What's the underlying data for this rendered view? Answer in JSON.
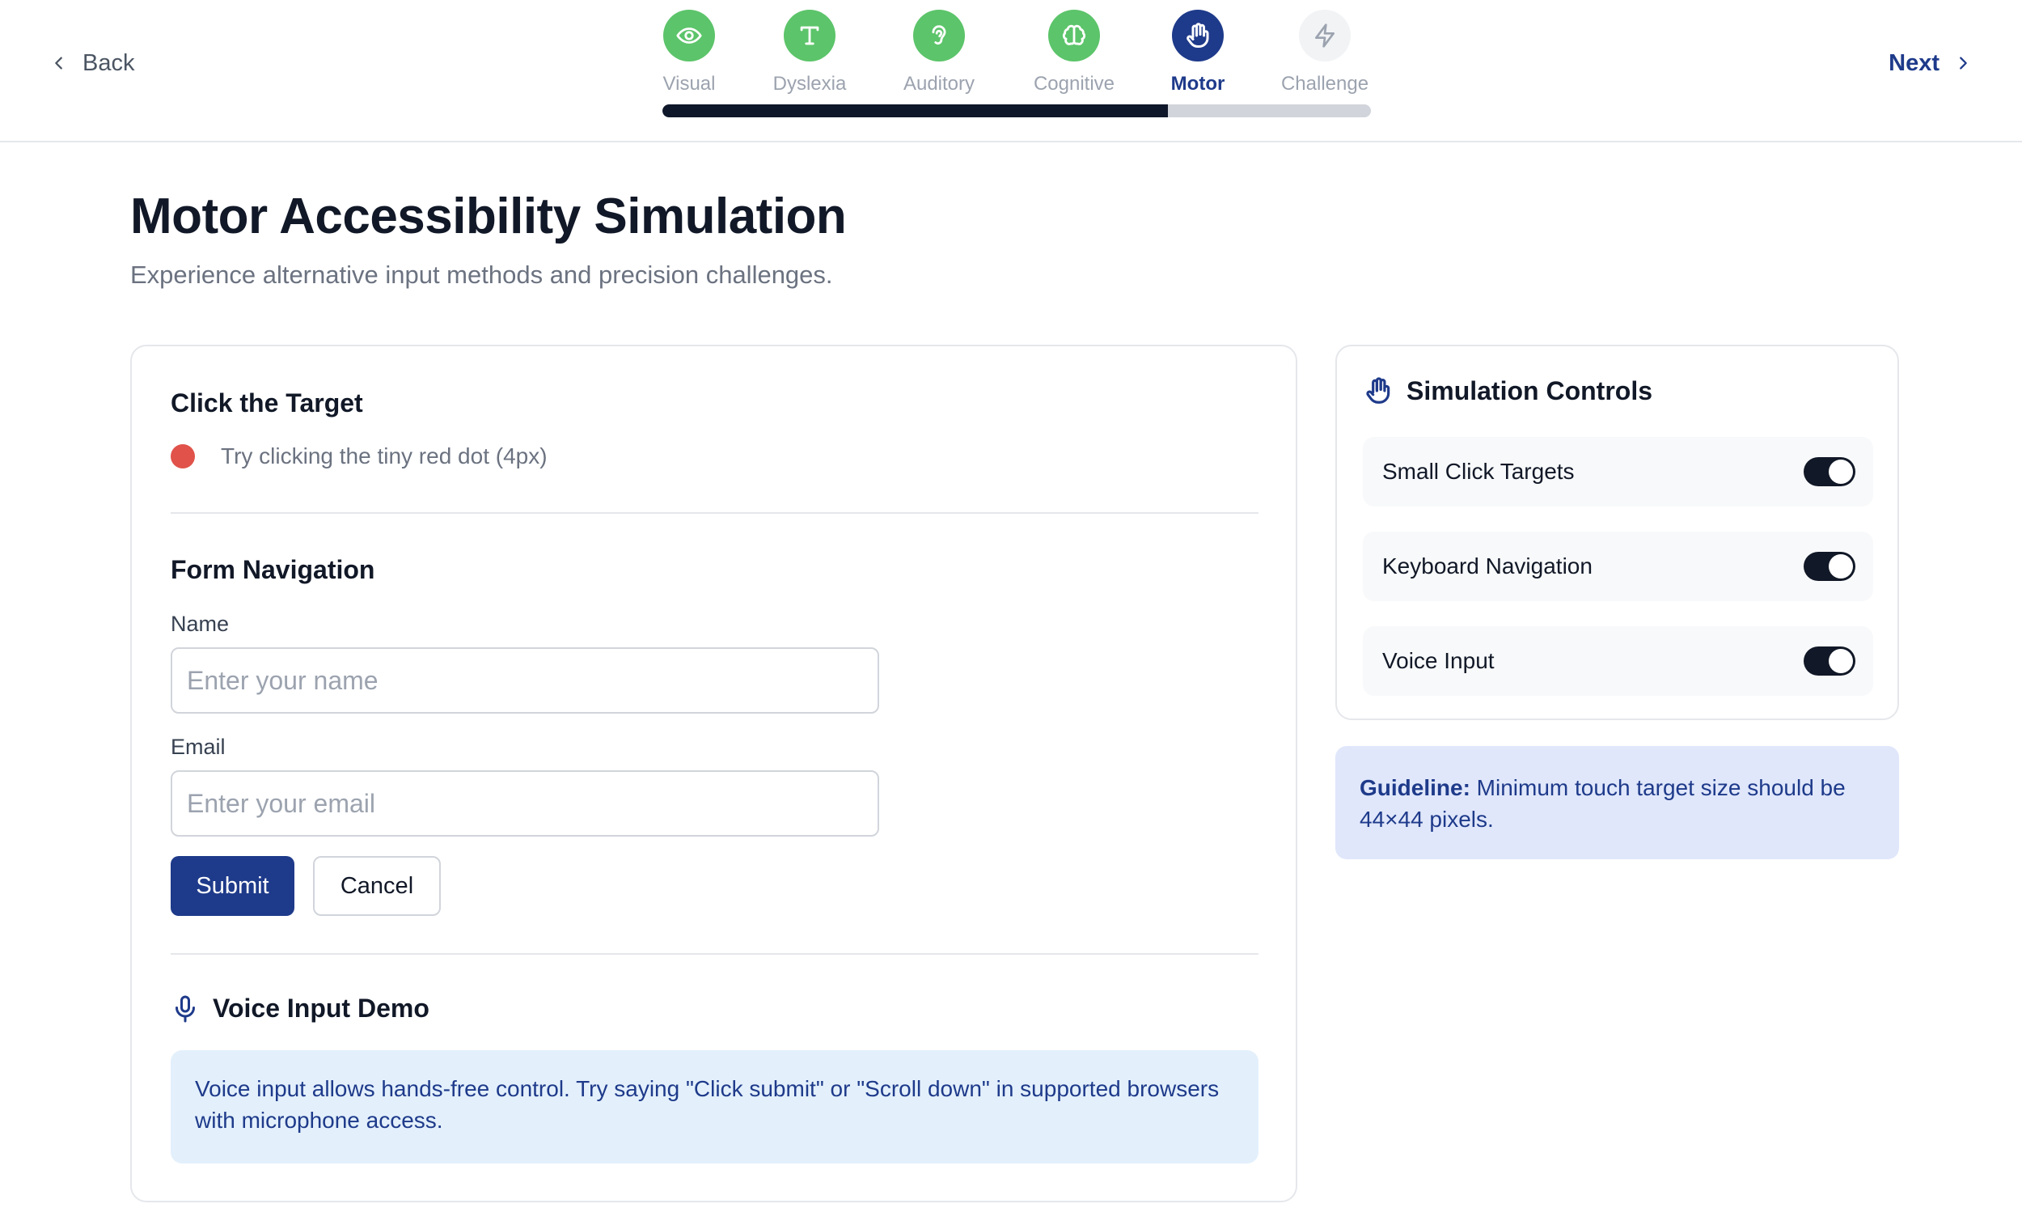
{
  "nav": {
    "back_label": "Back",
    "next_label": "Next",
    "progress_fraction": 0.714,
    "steps": [
      {
        "label": "Visual",
        "status": "done",
        "icon": "eye-icon"
      },
      {
        "label": "Dyslexia",
        "status": "done",
        "icon": "letter-t-icon"
      },
      {
        "label": "Auditory",
        "status": "done",
        "icon": "ear-icon"
      },
      {
        "label": "Cognitive",
        "status": "done",
        "icon": "brain-icon"
      },
      {
        "label": "Motor",
        "status": "active",
        "icon": "hand-icon"
      },
      {
        "label": "Challenge",
        "status": "todo",
        "icon": "lightning-icon"
      }
    ]
  },
  "header": {
    "title": "Motor Accessibility Simulation",
    "subtitle": "Experience alternative input methods and precision challenges."
  },
  "target": {
    "title": "Click the Target",
    "hint": "Try clicking the tiny red dot (4px)"
  },
  "form": {
    "title": "Form Navigation",
    "name_label": "Name",
    "name_placeholder": "Enter your name",
    "email_label": "Email",
    "email_placeholder": "Enter your email",
    "submit_label": "Submit",
    "cancel_label": "Cancel"
  },
  "voice": {
    "title": "Voice Input Demo",
    "description": "Voice input allows hands-free control. Try saying \"Click submit\" or \"Scroll down\" in supported browsers with microphone access."
  },
  "controls": {
    "title": "Simulation Controls",
    "toggles": [
      {
        "label": "Small Click Targets",
        "on": true
      },
      {
        "label": "Keyboard Navigation",
        "on": true
      },
      {
        "label": "Voice Input",
        "on": true
      }
    ]
  },
  "guideline": {
    "label": "Guideline:",
    "text": " Minimum touch target size should be 44×44 pixels."
  },
  "colors": {
    "accent": "#1e3a8a",
    "success": "#5cc46a",
    "target_dot": "#e0524a",
    "info_bg": "#e3f0fc",
    "guideline_bg": "#e0e7fb"
  }
}
